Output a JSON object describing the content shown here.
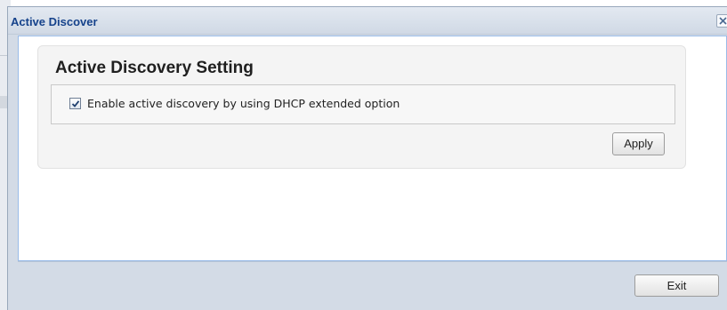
{
  "window": {
    "title": "Active Discover",
    "close_icon": "close-icon"
  },
  "panel": {
    "title": "Active Discovery Setting",
    "option": {
      "label": "Enable active discovery by using DHCP extended option",
      "checked": true
    },
    "apply_label": "Apply"
  },
  "footer": {
    "exit_label": "Exit"
  },
  "colors": {
    "title_text": "#15428b",
    "window_frame": "#d3dbe6",
    "content_border": "#99bbe8",
    "panel_bg": "#f4f4f4"
  }
}
